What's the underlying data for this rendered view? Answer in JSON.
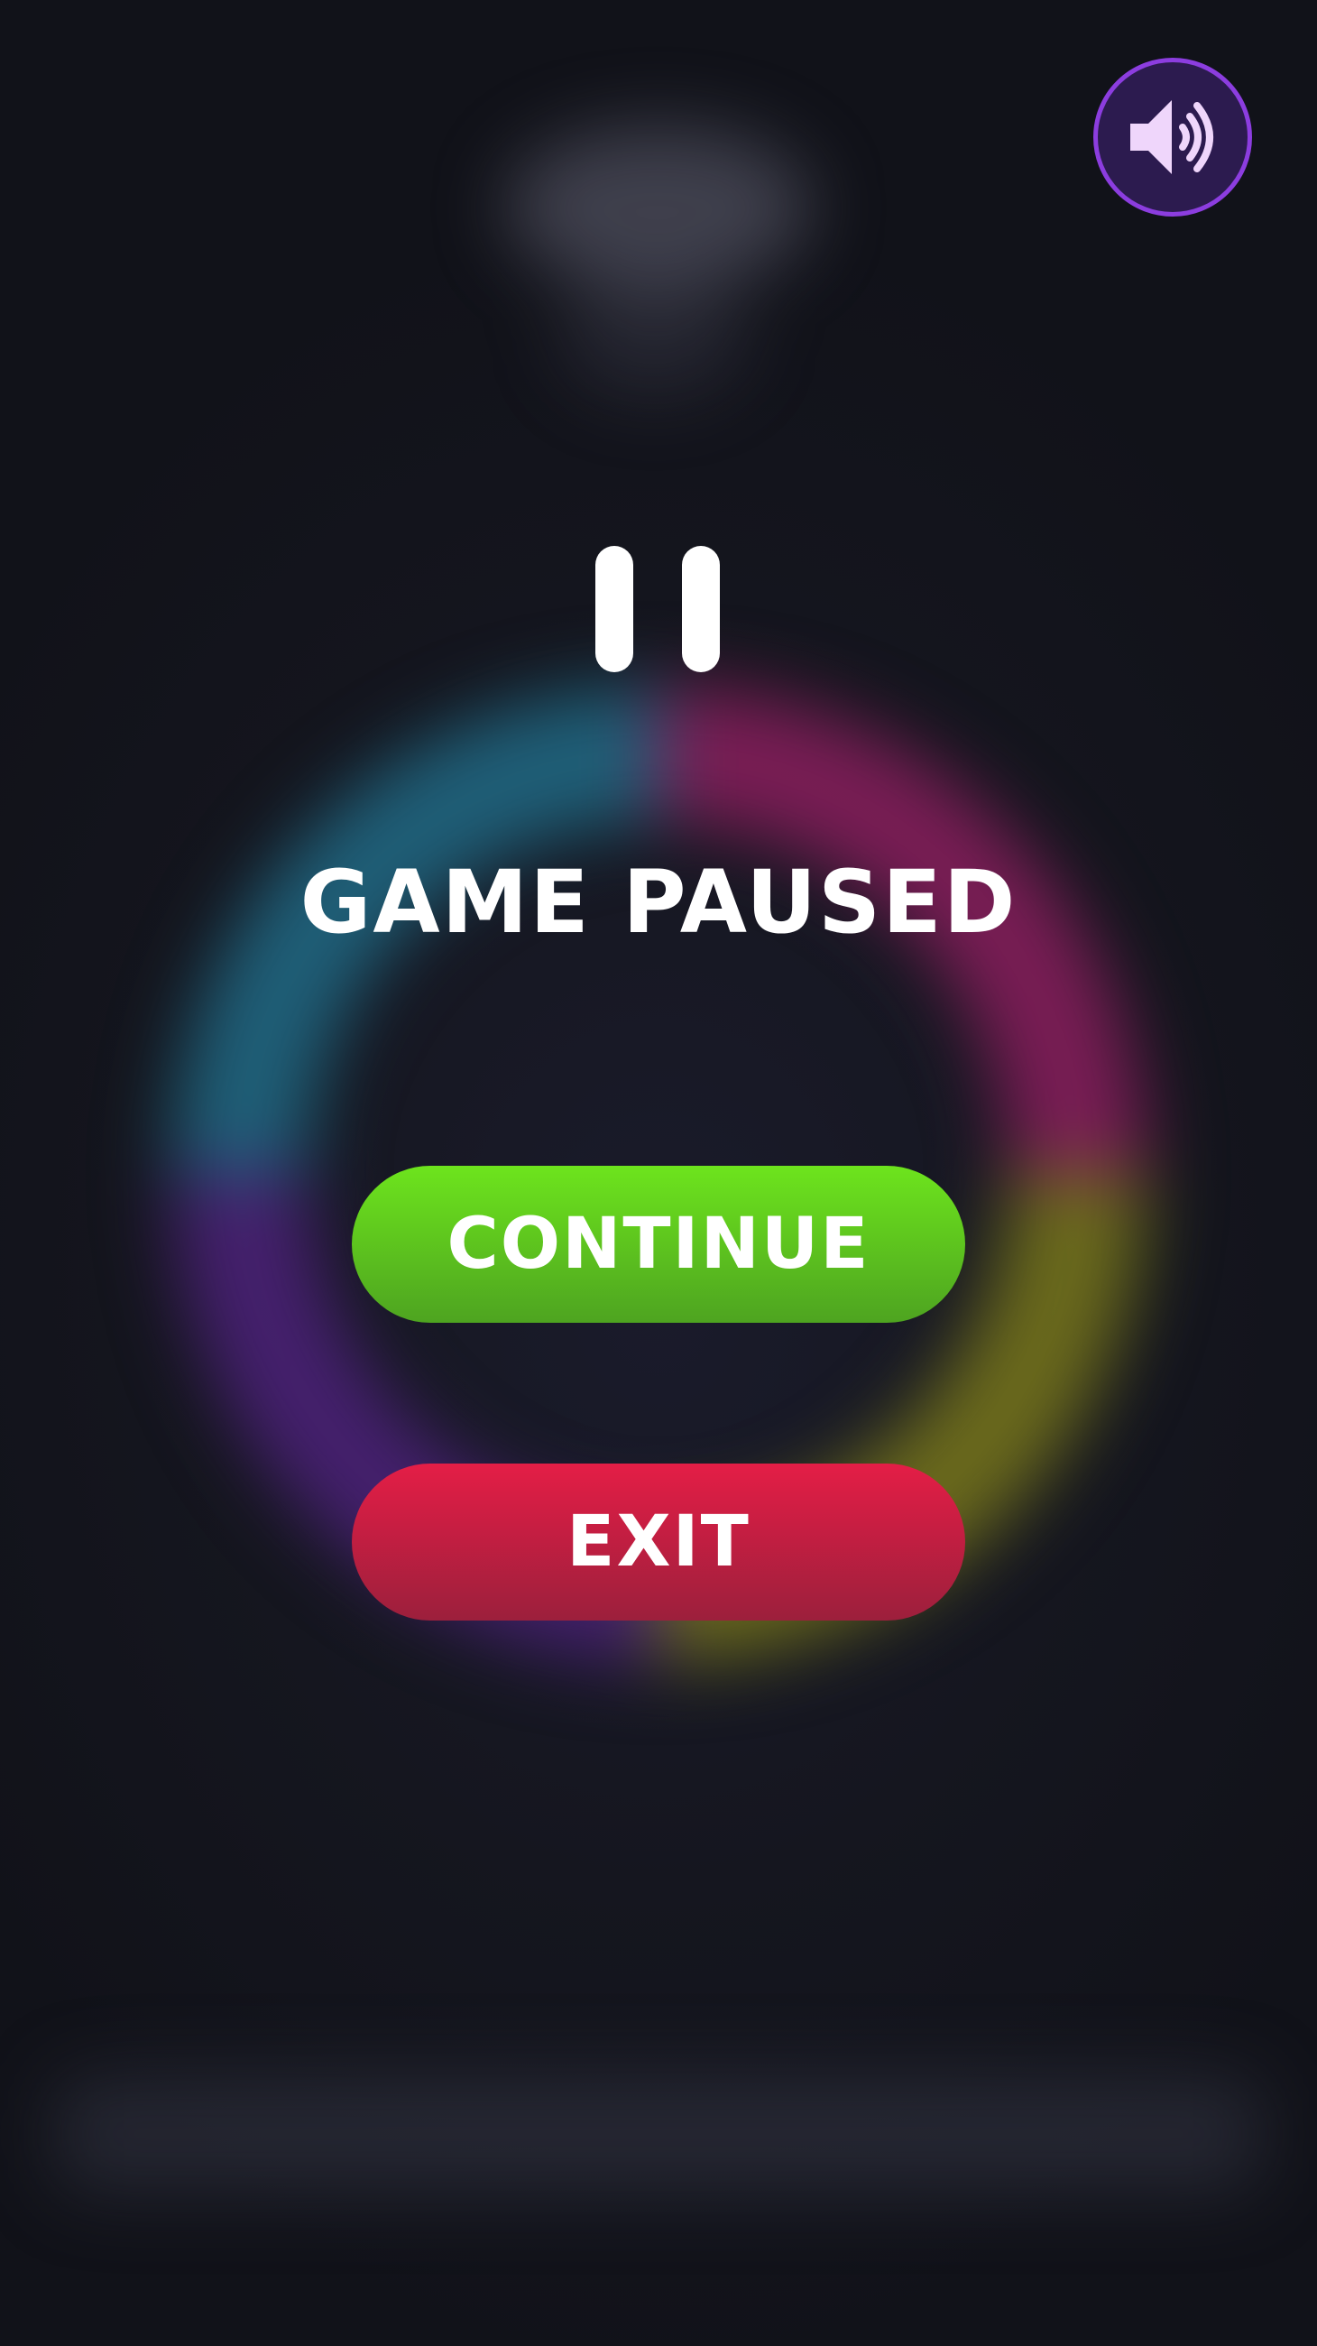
{
  "overlay": {
    "title": "GAME PAUSED",
    "continue_label": "CONTINUE",
    "exit_label": "EXIT"
  },
  "sound": {
    "icon": "speaker-on-icon",
    "state": "on"
  },
  "pause_icon": "pause-icon",
  "colors": {
    "continue": "#5fc21e",
    "exit": "#d01e42",
    "sound_border": "#8c3ddf",
    "sound_fill": "#2c1b4f",
    "ring_cyan": "#1f5f78",
    "ring_pink": "#7a1d55",
    "ring_yellow": "#6b6a1c",
    "ring_purple": "#45206e"
  }
}
